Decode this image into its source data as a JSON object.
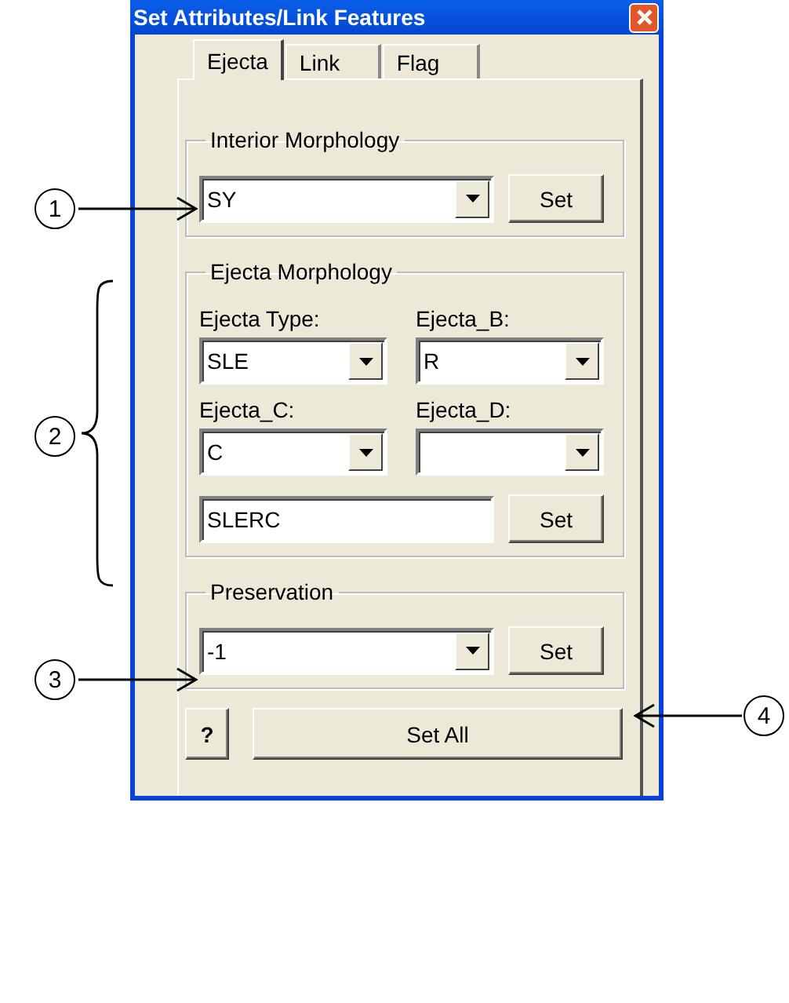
{
  "window": {
    "title": "Set Attributes/Link Features"
  },
  "tabs": [
    {
      "label": "Ejecta",
      "selected": true
    },
    {
      "label": "Link",
      "selected": false
    },
    {
      "label": "Flag",
      "selected": false
    }
  ],
  "interior_morphology": {
    "title": "Interior Morphology",
    "value": "SY",
    "button": "Set"
  },
  "ejecta_morphology": {
    "title": "Ejecta Morphology",
    "fields": [
      {
        "label": "Ejecta Type:",
        "value": "SLE"
      },
      {
        "label": "Ejecta_B:",
        "value": "R"
      },
      {
        "label": "Ejecta_C:",
        "value": "C"
      },
      {
        "label": "Ejecta_D:"
      }
    ],
    "code": "SLERC",
    "button": "Set"
  },
  "preservation": {
    "title": "Preservation",
    "value": "-1",
    "button": "Set"
  },
  "help_button": "?",
  "set_all_button": "Set All",
  "callouts": [
    {
      "number": "1",
      "kind": "arrow"
    },
    {
      "number": "2",
      "kind": "brace"
    },
    {
      "number": "3",
      "kind": "arrow"
    },
    {
      "number": "4",
      "kind": "arrow"
    }
  ]
}
